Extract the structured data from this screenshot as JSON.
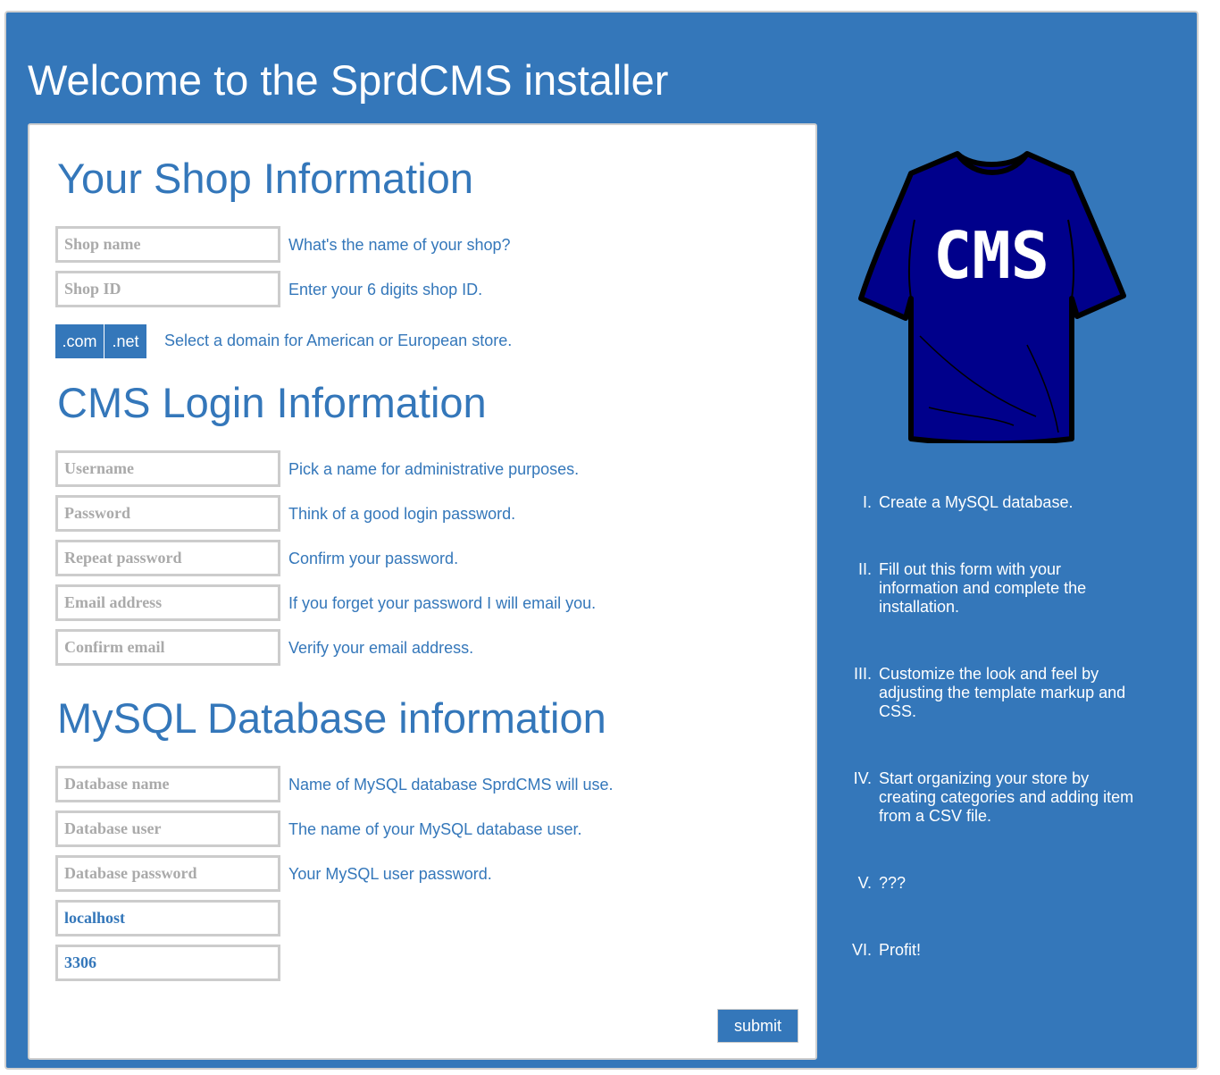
{
  "page_title": "Welcome to the SprdCMS installer",
  "shop_section": {
    "title": "Your Shop Information",
    "fields": [
      {
        "placeholder": "Shop name",
        "hint": "What's the name of your shop?"
      },
      {
        "placeholder": "Shop ID",
        "hint": "Enter your 6 digits shop ID."
      }
    ],
    "domain": {
      "options": [
        ".com",
        ".net"
      ],
      "hint": "Select a domain for American or European store."
    }
  },
  "login_section": {
    "title": "CMS Login Information",
    "fields": [
      {
        "placeholder": "Username",
        "hint": "Pick a name for administrative purposes."
      },
      {
        "placeholder": "Password",
        "hint": "Think of a good login password."
      },
      {
        "placeholder": "Repeat password",
        "hint": "Confirm your password."
      },
      {
        "placeholder": "Email address",
        "hint": "If you forget your password I will email you."
      },
      {
        "placeholder": "Confirm email",
        "hint": "Verify your email address."
      }
    ]
  },
  "db_section": {
    "title": "MySQL Database information",
    "fields": [
      {
        "placeholder": "Database name",
        "hint": "Name of MySQL database SprdCMS will use."
      },
      {
        "placeholder": "Database user",
        "hint": "The name of your MySQL database user."
      },
      {
        "placeholder": "Database password",
        "hint": "Your MySQL user password."
      },
      {
        "value": "localhost"
      },
      {
        "value": "3306"
      }
    ]
  },
  "submit_label": "submit",
  "logo": {
    "shirt_text": "CMS",
    "shirt_color": "#00008b"
  },
  "colors": {
    "brand_blue": "#3477ba",
    "border_gray": "#cccccc"
  },
  "steps": [
    {
      "num": "I.",
      "text": "Create a MySQL database."
    },
    {
      "num": "II.",
      "text": "Fill out this form with your information and complete the installation."
    },
    {
      "num": "III.",
      "text": "Customize the look and feel by adjusting the template markup and CSS."
    },
    {
      "num": "IV.",
      "text": "Start organizing your store by creating categories and adding item from a CSV file."
    },
    {
      "num": "V.",
      "text": "???"
    },
    {
      "num": "VI.",
      "text": "Profit!"
    }
  ]
}
